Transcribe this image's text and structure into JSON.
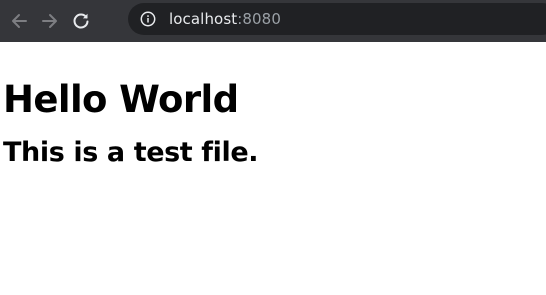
{
  "browser": {
    "url_host": "localhost",
    "url_port": ":8080",
    "icons": {
      "back": "arrow-left-icon",
      "forward": "arrow-right-icon",
      "reload": "reload-icon",
      "site_info": "info-icon"
    },
    "colors": {
      "toolbar_bg": "#35363a",
      "omnibox_bg": "#202124",
      "disabled_icon": "#7d7e82",
      "active_icon": "#e8eaed"
    }
  },
  "page": {
    "heading": "Hello World",
    "subheading": "This is a test file."
  }
}
